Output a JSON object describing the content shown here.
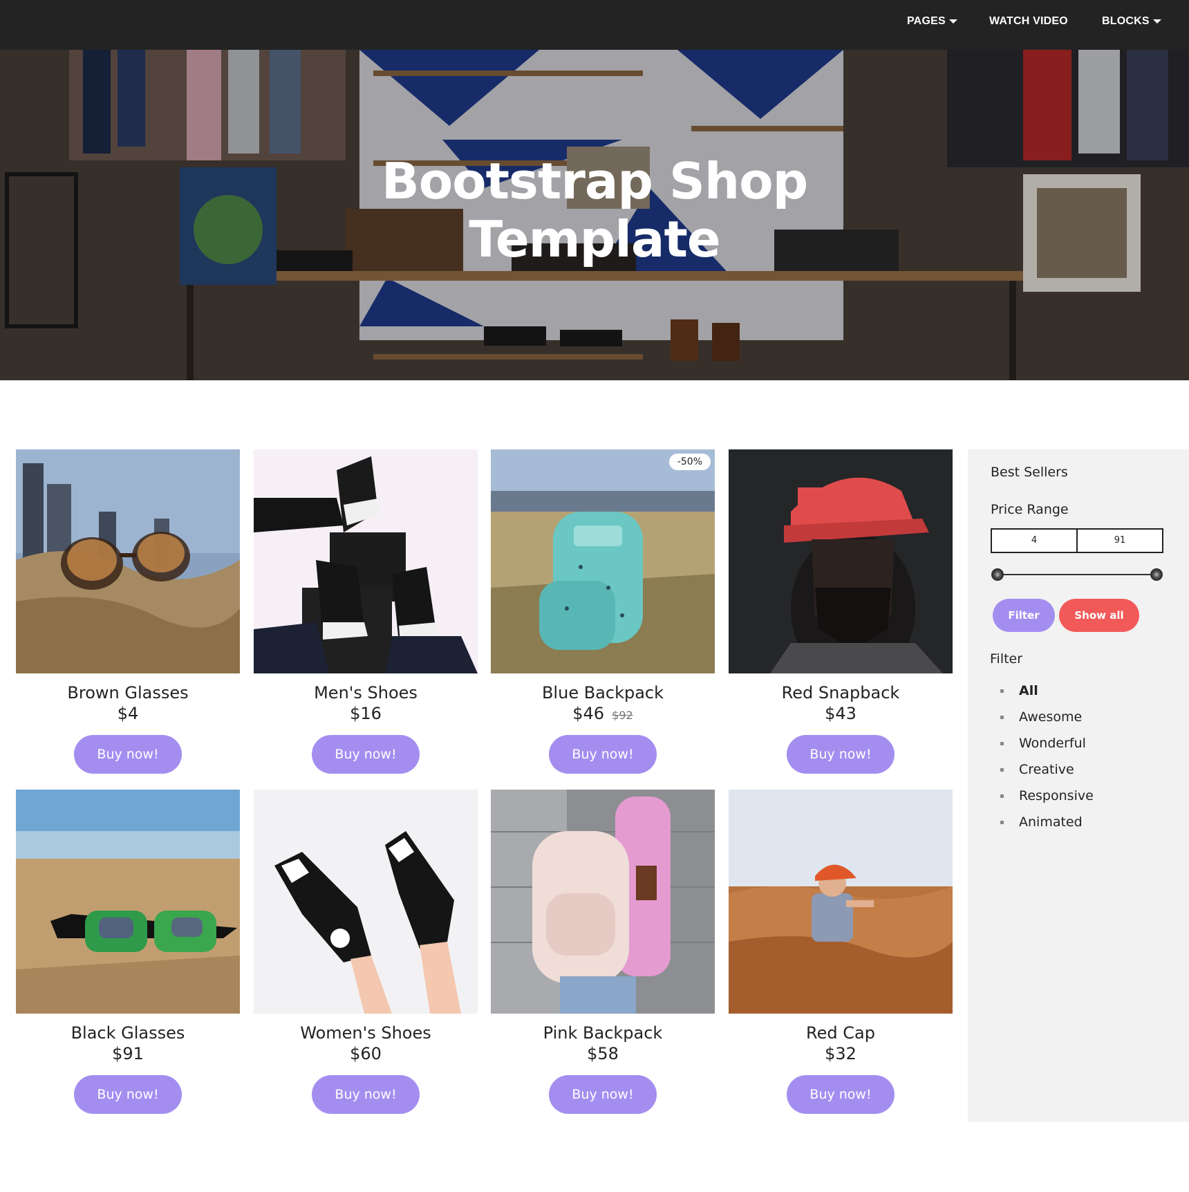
{
  "nav": {
    "pages_label": "PAGES",
    "video_label": "WATCH VIDEO",
    "blocks_label": "BLOCKS"
  },
  "hero": {
    "title_line1": "Bootstrap Shop",
    "title_line2": "Template"
  },
  "products": [
    {
      "name": "Brown Glasses",
      "price": "$4",
      "buy_label": "Buy now!"
    },
    {
      "name": "Men's Shoes",
      "price": "$16",
      "buy_label": "Buy now!"
    },
    {
      "name": "Blue Backpack",
      "price": "$46",
      "old_price": "$92",
      "badge": "-50%",
      "buy_label": "Buy now!"
    },
    {
      "name": "Red Snapback",
      "price": "$43",
      "buy_label": "Buy now!"
    },
    {
      "name": "Black Glasses",
      "price": "$91",
      "buy_label": "Buy now!"
    },
    {
      "name": "Women's Shoes",
      "price": "$60",
      "buy_label": "Buy now!"
    },
    {
      "name": "Pink Backpack",
      "price": "$58",
      "buy_label": "Buy now!"
    },
    {
      "name": "Red Cap",
      "price": "$32",
      "buy_label": "Buy now!"
    }
  ],
  "sidebar": {
    "best_sellers": "Best Sellers",
    "price_range_label": "Price Range",
    "range_min": "4",
    "range_max": "91",
    "filter_button": "Filter",
    "show_all_button": "Show all",
    "filter_heading": "Filter",
    "filters": [
      "All",
      "Awesome",
      "Wonderful",
      "Creative",
      "Responsive",
      "Animated"
    ]
  },
  "colors": {
    "nav_bg": "#232323",
    "accent_purple": "#a38ef0",
    "show_all_red": "#f25a5a",
    "sidebar_bg": "#f2f2f2"
  }
}
